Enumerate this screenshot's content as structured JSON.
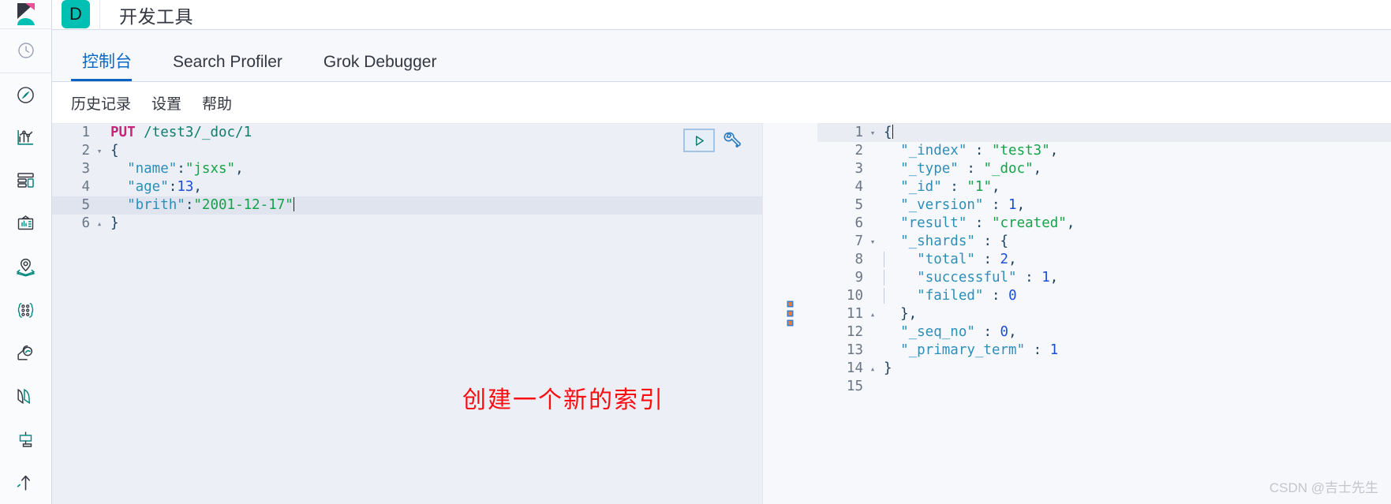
{
  "rail": {
    "logo_name": "kibana-logo",
    "icons": [
      {
        "name": "recently-viewed-icon",
        "label": "最近查看"
      },
      {
        "name": "discover-compass-icon",
        "label": "Discover"
      },
      {
        "name": "visualize-chart-icon",
        "label": "Visualize"
      },
      {
        "name": "dashboard-icon",
        "label": "Dashboard"
      },
      {
        "name": "canvas-icon",
        "label": "Canvas"
      },
      {
        "name": "maps-icon",
        "label": "Maps"
      },
      {
        "name": "machine-learning-icon",
        "label": "Machine Learning"
      },
      {
        "name": "observability-icon",
        "label": "Observability"
      },
      {
        "name": "security-icon",
        "label": "Security"
      },
      {
        "name": "management-icon",
        "label": "Management"
      },
      {
        "name": "uptime-icon",
        "label": "Uptime"
      }
    ]
  },
  "appbar": {
    "badge_letter": "D",
    "title": "开发工具",
    "badge_color": "#00bfb3"
  },
  "tabs": [
    {
      "label": "控制台",
      "active": true,
      "name": "tab-console"
    },
    {
      "label": "Search Profiler",
      "active": false,
      "name": "tab-search-profiler"
    },
    {
      "label": "Grok Debugger",
      "active": false,
      "name": "tab-grok-debugger"
    }
  ],
  "submenu": [
    {
      "label": "历史记录",
      "name": "menu-history"
    },
    {
      "label": "设置",
      "name": "menu-settings"
    },
    {
      "label": "帮助",
      "name": "menu-help"
    }
  ],
  "editor": {
    "run_button_label": "▷",
    "wrench_label": "wrench",
    "lines": [
      {
        "num": "1",
        "fold": "",
        "highlight": false,
        "tokens": [
          {
            "t": "PUT",
            "c": "m"
          },
          {
            "t": " ",
            "c": "p"
          },
          {
            "t": "/test3/_doc/1",
            "c": "u"
          }
        ]
      },
      {
        "num": "2",
        "fold": "▾",
        "highlight": false,
        "tokens": [
          {
            "t": "{",
            "c": "br"
          }
        ]
      },
      {
        "num": "3",
        "fold": "",
        "highlight": false,
        "tokens": [
          {
            "t": "  ",
            "c": "p"
          },
          {
            "t": "\"name\"",
            "c": "k"
          },
          {
            "t": ":",
            "c": "p"
          },
          {
            "t": "\"jsxs\"",
            "c": "s"
          },
          {
            "t": ",",
            "c": "p"
          }
        ]
      },
      {
        "num": "4",
        "fold": "",
        "highlight": false,
        "tokens": [
          {
            "t": "  ",
            "c": "p"
          },
          {
            "t": "\"age\"",
            "c": "k"
          },
          {
            "t": ":",
            "c": "p"
          },
          {
            "t": "13",
            "c": "n"
          },
          {
            "t": ",",
            "c": "p"
          }
        ]
      },
      {
        "num": "5",
        "fold": "",
        "highlight": true,
        "cursor": true,
        "tokens": [
          {
            "t": "  ",
            "c": "p"
          },
          {
            "t": "\"brith\"",
            "c": "k"
          },
          {
            "t": ":",
            "c": "p"
          },
          {
            "t": "\"2001-12-17\"",
            "c": "s"
          }
        ]
      },
      {
        "num": "6",
        "fold": "▴",
        "highlight": false,
        "tokens": [
          {
            "t": "}",
            "c": "br"
          }
        ]
      }
    ]
  },
  "annotation": {
    "text": "创建一个新的索引",
    "color": "#fc0d12"
  },
  "output": {
    "lines": [
      {
        "num": "1",
        "fold": "▾",
        "highlight": true,
        "cursor": true,
        "indent": 0,
        "tokens": [
          {
            "t": "{",
            "c": "br"
          }
        ]
      },
      {
        "num": "2",
        "fold": "",
        "highlight": false,
        "indent": 0,
        "tokens": [
          {
            "t": "  ",
            "c": "p"
          },
          {
            "t": "\"_index\"",
            "c": "k"
          },
          {
            "t": " : ",
            "c": "p"
          },
          {
            "t": "\"test3\"",
            "c": "s"
          },
          {
            "t": ",",
            "c": "p"
          }
        ]
      },
      {
        "num": "3",
        "fold": "",
        "highlight": false,
        "indent": 0,
        "tokens": [
          {
            "t": "  ",
            "c": "p"
          },
          {
            "t": "\"_type\"",
            "c": "k"
          },
          {
            "t": " : ",
            "c": "p"
          },
          {
            "t": "\"_doc\"",
            "c": "s"
          },
          {
            "t": ",",
            "c": "p"
          }
        ]
      },
      {
        "num": "4",
        "fold": "",
        "highlight": false,
        "indent": 0,
        "tokens": [
          {
            "t": "  ",
            "c": "p"
          },
          {
            "t": "\"_id\"",
            "c": "k"
          },
          {
            "t": " : ",
            "c": "p"
          },
          {
            "t": "\"1\"",
            "c": "s"
          },
          {
            "t": ",",
            "c": "p"
          }
        ]
      },
      {
        "num": "5",
        "fold": "",
        "highlight": false,
        "indent": 0,
        "tokens": [
          {
            "t": "  ",
            "c": "p"
          },
          {
            "t": "\"_version\"",
            "c": "k"
          },
          {
            "t": " : ",
            "c": "p"
          },
          {
            "t": "1",
            "c": "n"
          },
          {
            "t": ",",
            "c": "p"
          }
        ]
      },
      {
        "num": "6",
        "fold": "",
        "highlight": false,
        "indent": 0,
        "tokens": [
          {
            "t": "  ",
            "c": "p"
          },
          {
            "t": "\"result\"",
            "c": "k"
          },
          {
            "t": " : ",
            "c": "p"
          },
          {
            "t": "\"created\"",
            "c": "s"
          },
          {
            "t": ",",
            "c": "p"
          }
        ]
      },
      {
        "num": "7",
        "fold": "▾",
        "highlight": false,
        "indent": 0,
        "tokens": [
          {
            "t": "  ",
            "c": "p"
          },
          {
            "t": "\"_shards\"",
            "c": "k"
          },
          {
            "t": " : ",
            "c": "p"
          },
          {
            "t": "{",
            "c": "br"
          }
        ]
      },
      {
        "num": "8",
        "fold": "",
        "highlight": false,
        "indent": 1,
        "tokens": [
          {
            "t": "  ",
            "c": "p"
          },
          {
            "t": "\"total\"",
            "c": "k"
          },
          {
            "t": " : ",
            "c": "p"
          },
          {
            "t": "2",
            "c": "n"
          },
          {
            "t": ",",
            "c": "p"
          }
        ]
      },
      {
        "num": "9",
        "fold": "",
        "highlight": false,
        "indent": 1,
        "tokens": [
          {
            "t": "  ",
            "c": "p"
          },
          {
            "t": "\"successful\"",
            "c": "k"
          },
          {
            "t": " : ",
            "c": "p"
          },
          {
            "t": "1",
            "c": "n"
          },
          {
            "t": ",",
            "c": "p"
          }
        ]
      },
      {
        "num": "10",
        "fold": "",
        "highlight": false,
        "indent": 1,
        "tokens": [
          {
            "t": "  ",
            "c": "p"
          },
          {
            "t": "\"failed\"",
            "c": "k"
          },
          {
            "t": " : ",
            "c": "p"
          },
          {
            "t": "0",
            "c": "n"
          }
        ]
      },
      {
        "num": "11",
        "fold": "▴",
        "highlight": false,
        "indent": 0,
        "tokens": [
          {
            "t": "  ",
            "c": "p"
          },
          {
            "t": "},",
            "c": "br"
          }
        ]
      },
      {
        "num": "12",
        "fold": "",
        "highlight": false,
        "indent": 0,
        "tokens": [
          {
            "t": "  ",
            "c": "p"
          },
          {
            "t": "\"_seq_no\"",
            "c": "k"
          },
          {
            "t": " : ",
            "c": "p"
          },
          {
            "t": "0",
            "c": "n"
          },
          {
            "t": ",",
            "c": "p"
          }
        ]
      },
      {
        "num": "13",
        "fold": "",
        "highlight": false,
        "indent": 0,
        "tokens": [
          {
            "t": "  ",
            "c": "p"
          },
          {
            "t": "\"_primary_term\"",
            "c": "k"
          },
          {
            "t": " : ",
            "c": "p"
          },
          {
            "t": "1",
            "c": "n"
          }
        ]
      },
      {
        "num": "14",
        "fold": "▴",
        "highlight": false,
        "indent": 0,
        "tokens": [
          {
            "t": "}",
            "c": "br"
          }
        ]
      },
      {
        "num": "15",
        "fold": "",
        "highlight": false,
        "indent": 0,
        "tokens": []
      }
    ]
  },
  "watermark": {
    "text": "CSDN @吉士先生"
  }
}
